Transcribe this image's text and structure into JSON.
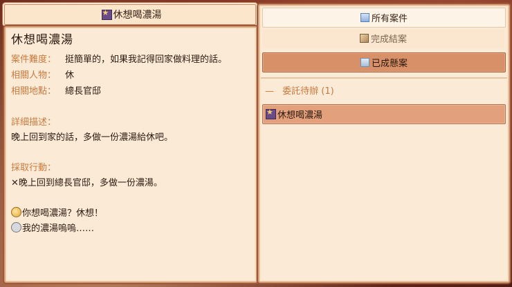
{
  "case": {
    "title": "休想喝濃湯",
    "difficulty_label": "案件難度：",
    "difficulty": "挺簡單的，如果我記得回家做料理的話。",
    "people_label": "相關人物：",
    "people": "休",
    "location_label": "相關地點：",
    "location": "總長官邸",
    "description_label": "詳細描述：",
    "description": "晚上回到家的話，多做一份濃湯給休吧。",
    "action_label": "採取行動：",
    "action": "晚上回到總長官邸，多做一份濃湯。",
    "action_mark": "✕",
    "dialogue": [
      {
        "icon": "sun-face-icon",
        "text": "你想喝濃湯？休想！"
      },
      {
        "icon": "ghost-face-icon",
        "text": "我的濃湯嗚嗚……"
      }
    ]
  },
  "tabs": {
    "all": "所有案件",
    "completed": "完成結案",
    "unsolved": "已成懸案"
  },
  "group": {
    "collapse_symbol": "—",
    "label": "委託待辦",
    "count": "(1)"
  },
  "list_items": [
    {
      "label": "休想喝濃湯",
      "icon": "star-case-icon"
    }
  ],
  "colors": {
    "panel_bg": "#fbebd6",
    "label_orange": "#c87a40",
    "selected_item": "#e3a07c",
    "active_tab": "#d79067"
  }
}
